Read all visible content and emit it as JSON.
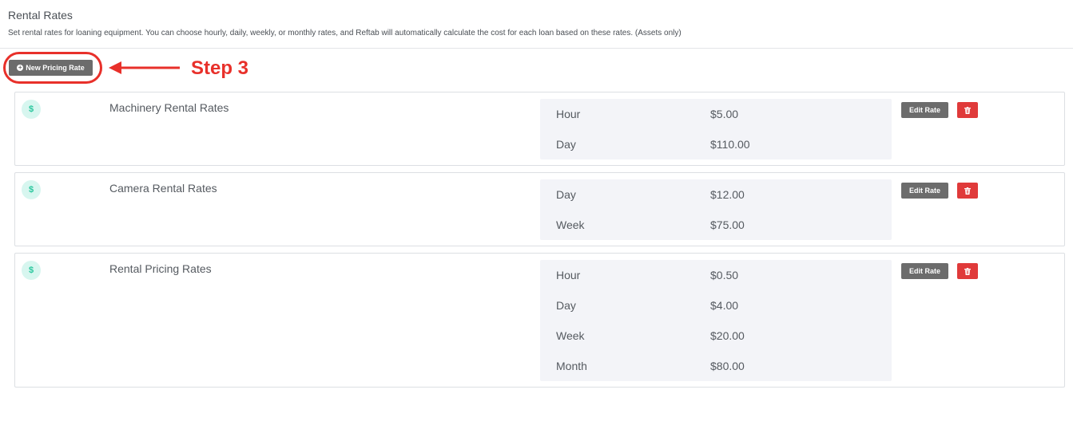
{
  "header": {
    "title": "Rental Rates",
    "description": "Set rental rates for loaning equipment. You can choose hourly, daily, weekly, or monthly rates, and Reftab will automatically calculate the cost for each loan based on these rates. (Assets only)"
  },
  "toolbar": {
    "new_label": "New Pricing Rate"
  },
  "annotation": {
    "step_label": "Step 3",
    "color": "#e8302a"
  },
  "icons": {
    "coin": "dollar-icon",
    "coin_glyph": "$",
    "add": "plus-circle-icon",
    "add_glyph": "+",
    "delete": "trash-icon"
  },
  "rate_cards": [
    {
      "name": "Machinery Rental Rates",
      "edit_label": "Edit Rate",
      "rates": [
        {
          "unit": "Hour",
          "price": "$5.00"
        },
        {
          "unit": "Day",
          "price": "$110.00"
        }
      ]
    },
    {
      "name": "Camera Rental Rates",
      "edit_label": "Edit Rate",
      "rates": [
        {
          "unit": "Day",
          "price": "$12.00"
        },
        {
          "unit": "Week",
          "price": "$75.00"
        }
      ]
    },
    {
      "name": "Rental Pricing Rates",
      "edit_label": "Edit Rate",
      "rates": [
        {
          "unit": "Hour",
          "price": "$0.50"
        },
        {
          "unit": "Day",
          "price": "$4.00"
        },
        {
          "unit": "Week",
          "price": "$20.00"
        },
        {
          "unit": "Month",
          "price": "$80.00"
        }
      ]
    }
  ],
  "colors": {
    "accent_green": "#2bc79e",
    "button_gray": "#6c6c6c",
    "danger_red": "#e03a3a"
  }
}
